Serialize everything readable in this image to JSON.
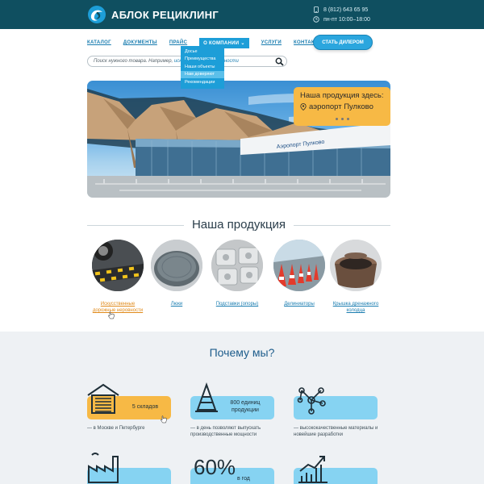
{
  "header": {
    "brand": "АБЛОК РЕЦИКЛИНГ",
    "phone": "8 (812) 643 65 95",
    "hours": "пн-пт 10:00–18:00"
  },
  "nav": {
    "items": [
      "КАТАЛОГ",
      "ДОКУМЕНТЫ",
      "ПРАЙС",
      "О КОМПАНИИ",
      "УСЛУГИ",
      "КОНТАКТЫ"
    ],
    "dealer_button": "СТАТЬ ДИЛЕРОМ",
    "dropdown": [
      "Досье",
      "Преимущества",
      "Наши объекты",
      "Нам доверяют",
      "Рекомендации"
    ]
  },
  "search": {
    "placeholder": "Поиск нужного товара. Например,",
    "example": "искусственные неровности"
  },
  "hero": {
    "promo_title": "Наша продукция здесь:",
    "promo_location": "аэропорт Пулково",
    "sign": "Аэропорт Пулково"
  },
  "products": {
    "title": "Наша продукция",
    "items": [
      "Искусственные дорожные неровности",
      "Люки",
      "Подставки (опоры)",
      "Делиниаторы",
      "Крышка дренажного колодца"
    ]
  },
  "why": {
    "title": "Почему мы?",
    "features": [
      {
        "value": "5 складов",
        "caption": "— в Москве и Петербурге"
      },
      {
        "value": "800 единиц продукции",
        "caption": "— в день позволяют выпускать производственные мощности"
      },
      {
        "value": "",
        "caption": "— высококачественные материалы и новейшие разработки"
      },
      {
        "value": "",
        "caption": ""
      },
      {
        "value_big": "60%",
        "value_small": "в год",
        "caption": ""
      },
      {
        "value": "",
        "caption": ""
      }
    ]
  },
  "colors": {
    "header_bg": "#0f4f60",
    "accent_blue": "#1d9ed8",
    "accent_orange": "#f7b945",
    "feature_blue": "#86d3f2"
  }
}
